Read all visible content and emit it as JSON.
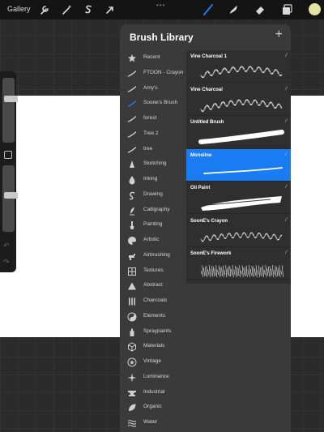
{
  "topbar": {
    "gallery_label": "Gallery",
    "icons": [
      "wrench-icon",
      "magic-wand-icon",
      "selection-s-icon",
      "transform-arrow-icon",
      "brush-icon",
      "smudge-icon",
      "eraser-icon",
      "layers-icon"
    ],
    "active_tool": "brush-icon",
    "accent_color": "#1a7cf2",
    "current_color": "#e6e3a2"
  },
  "sidebar": {
    "size_slider_value": 0.3,
    "opacity_slider_value": 0.45,
    "undo_label": "↶",
    "redo_label": "↷"
  },
  "brush_library": {
    "title": "Brush Library",
    "add_label": "+",
    "categories": [
      {
        "label": "Recent",
        "icon": "star-icon"
      },
      {
        "label": "FTOON - Crayon",
        "icon": "brush-stroke-icon"
      },
      {
        "label": "Amy's",
        "icon": "brush-stroke-icon"
      },
      {
        "label": "Soone's Brush",
        "icon": "brush-stroke-icon",
        "selected": true
      },
      {
        "label": "forest",
        "icon": "brush-stroke-icon"
      },
      {
        "label": "Tree 2",
        "icon": "brush-stroke-icon"
      },
      {
        "label": "tree",
        "icon": "brush-stroke-icon"
      },
      {
        "label": "Sketching",
        "icon": "pencil-tip-icon"
      },
      {
        "label": "Inking",
        "icon": "ink-drop-icon"
      },
      {
        "label": "Drawing",
        "icon": "swirl-icon"
      },
      {
        "label": "Calligraphy",
        "icon": "calligraphy-icon"
      },
      {
        "label": "Painting",
        "icon": "paint-brush-icon"
      },
      {
        "label": "Artistic",
        "icon": "palette-icon"
      },
      {
        "label": "Airbrushing",
        "icon": "airbrush-icon"
      },
      {
        "label": "Textures",
        "icon": "texture-grid-icon"
      },
      {
        "label": "Abstract",
        "icon": "triangle-icon"
      },
      {
        "label": "Charcoals",
        "icon": "charcoal-bars-icon"
      },
      {
        "label": "Elements",
        "icon": "yin-yang-icon"
      },
      {
        "label": "Spraypaints",
        "icon": "spray-can-icon"
      },
      {
        "label": "Materials",
        "icon": "cube-icon"
      },
      {
        "label": "Vintage",
        "icon": "vintage-star-icon"
      },
      {
        "label": "Luminance",
        "icon": "sparkle-icon"
      },
      {
        "label": "Industrial",
        "icon": "anvil-icon"
      },
      {
        "label": "Organic",
        "icon": "leaf-icon"
      },
      {
        "label": "Water",
        "icon": "waves-icon"
      }
    ],
    "brushes": [
      {
        "name": "Vine Charcoal 1",
        "selected": false
      },
      {
        "name": "Vine Charcoal",
        "selected": false
      },
      {
        "name": "Untitled Brush",
        "selected": false
      },
      {
        "name": "Monoline",
        "selected": true
      },
      {
        "name": "Oil Paint",
        "selected": false
      },
      {
        "name": "SoonE's Crayon",
        "selected": false
      },
      {
        "name": "SoonE's Firework",
        "selected": false
      }
    ]
  }
}
